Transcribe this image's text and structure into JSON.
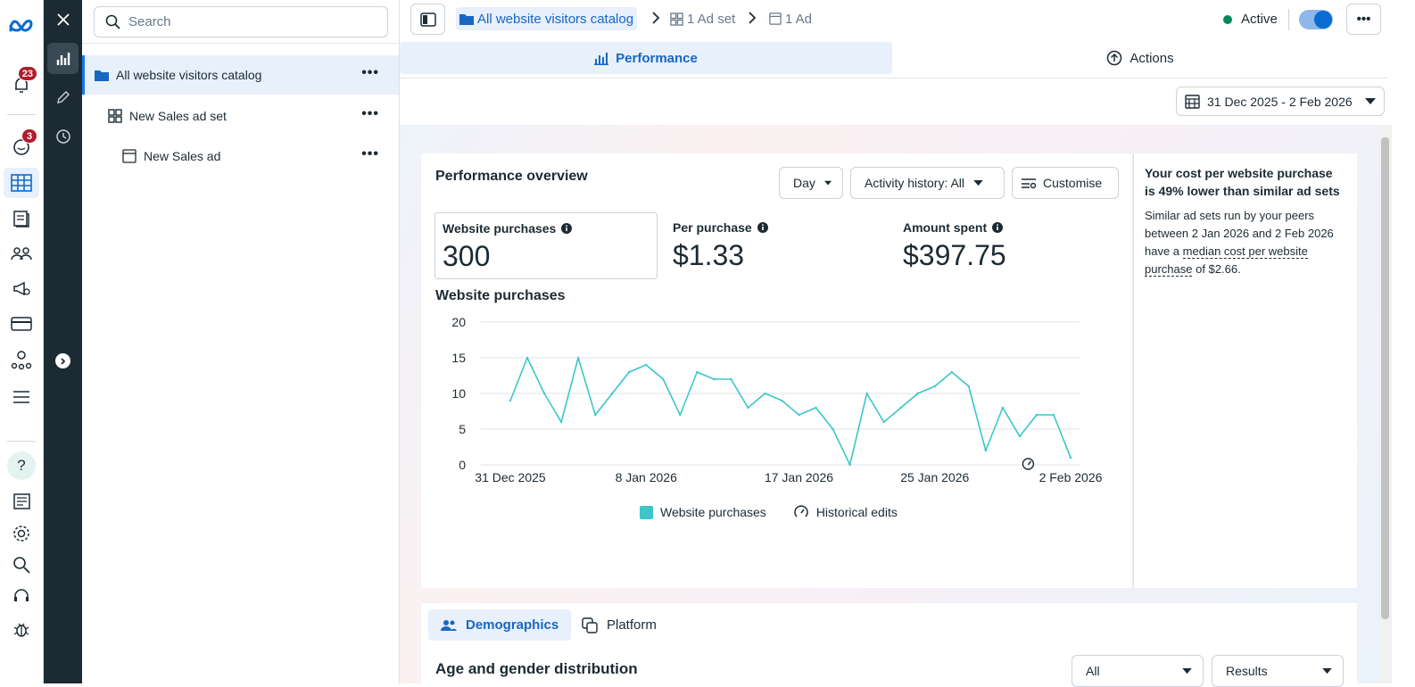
{
  "rail": {
    "notifications_badge": "23",
    "messages_badge": "3"
  },
  "tree": {
    "search_placeholder": "Search",
    "items": [
      {
        "label": "All website visitors catalog",
        "type": "campaign"
      },
      {
        "label": "New Sales ad set",
        "type": "adset"
      },
      {
        "label": "New Sales ad",
        "type": "ad"
      }
    ]
  },
  "breadcrumb": {
    "campaign": "All website visitors catalog",
    "adset": "1 Ad set",
    "ad": "1 Ad"
  },
  "status": {
    "label": "Active",
    "toggle_on": true
  },
  "tabs": {
    "performance": "Performance",
    "actions": "Actions"
  },
  "date_range": "31 Dec 2025 - 2 Feb 2026",
  "overview": {
    "title": "Performance overview",
    "granularity": "Day",
    "activity": "Activity history: All",
    "customise": "Customise",
    "metrics": [
      {
        "label": "Website purchases",
        "value": "300"
      },
      {
        "label": "Per purchase",
        "value": "$1.33"
      },
      {
        "label": "Amount spent",
        "value": "$397.75"
      }
    ],
    "chart_title": "Website purchases",
    "legend": {
      "series": "Website purchases",
      "edits": "Historical edits"
    }
  },
  "chart_data": {
    "type": "line",
    "ylim": [
      0,
      20
    ],
    "yticks": [
      "0",
      "5",
      "10",
      "15",
      "20"
    ],
    "xtick_labels": [
      "31 Dec 2025",
      "8 Jan 2026",
      "17 Jan 2026",
      "25 Jan 2026",
      "2 Feb 2026"
    ],
    "xtick_index": [
      0,
      8,
      17,
      25,
      33
    ],
    "series": [
      {
        "name": "Website purchases",
        "color": "#3cc6c8",
        "values": [
          9,
          15,
          10,
          6,
          15,
          7,
          10,
          13,
          14,
          12,
          7,
          13,
          12,
          12,
          8,
          10,
          9,
          7,
          8,
          5,
          0,
          10,
          6,
          8,
          10,
          11,
          13,
          11,
          2,
          8,
          4,
          7,
          7,
          1
        ]
      }
    ],
    "historical_edit_index": 30.5
  },
  "insight": {
    "title": "Your cost per website purchase is 49% lower than similar ad sets",
    "body_pre": "Similar ad sets run by your peers between 2 Jan 2026 and 2 Feb 2026 have a ",
    "body_link": "median cost per website purchase",
    "body_post": " of $2.66."
  },
  "bottom": {
    "tab_demographics": "Demographics",
    "tab_platform": "Platform",
    "title": "Age and gender distribution",
    "filter_all": "All",
    "filter_results": "Results"
  },
  "colors": {
    "accent": "#1867c3",
    "dark_rail": "#1c2b33",
    "line": "#3cc6c8",
    "active_dot": "#00875a"
  }
}
